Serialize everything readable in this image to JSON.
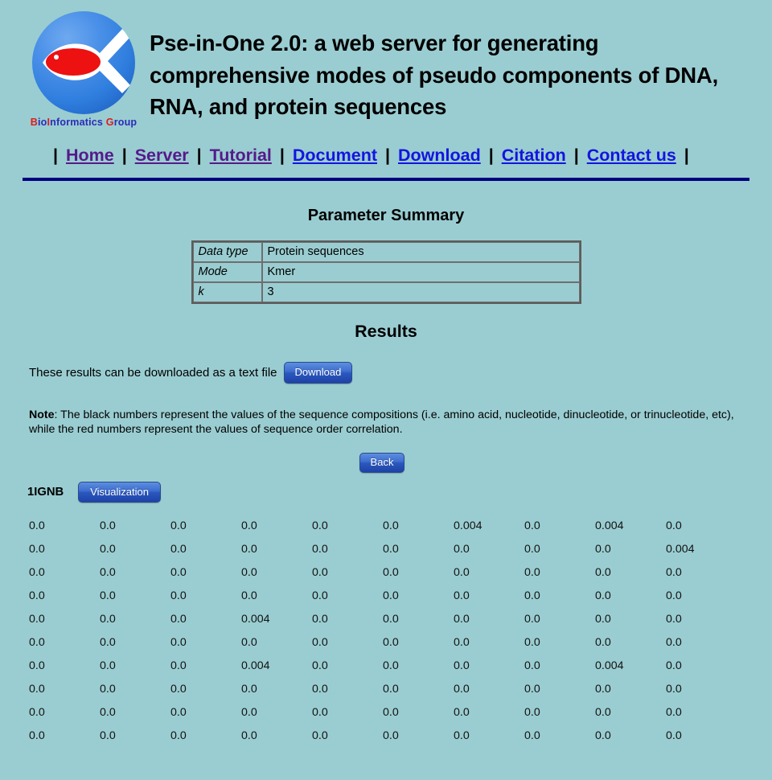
{
  "site": {
    "logo_caption_parts": [
      "B",
      "io",
      "I",
      "nformatics ",
      "G",
      "roup"
    ],
    "logo_caption": "BioInformatics Group",
    "logo_icon": "fish-sphere-logo",
    "title": "Pse-in-One 2.0: a web server for generating comprehensive modes of pseudo components of DNA, RNA, and protein sequences"
  },
  "nav": {
    "leading_sep": "|",
    "trailing_sep": "|",
    "sep": "|",
    "items": [
      {
        "label": "Home",
        "state": "visited"
      },
      {
        "label": "Server",
        "state": "visited"
      },
      {
        "label": "Tutorial",
        "state": "visited"
      },
      {
        "label": "Document",
        "state": "unvisited"
      },
      {
        "label": "Download",
        "state": "unvisited"
      },
      {
        "label": "Citation",
        "state": "unvisited"
      },
      {
        "label": "Contact us",
        "state": "unvisited"
      }
    ]
  },
  "parameter_summary": {
    "heading": "Parameter Summary",
    "rows": [
      {
        "key": "Data type",
        "value": "Protein sequences"
      },
      {
        "key": "Mode",
        "value": "Kmer"
      },
      {
        "key": "k",
        "value": "3"
      }
    ]
  },
  "results": {
    "heading": "Results",
    "download_text": "These results can be downloaded as a text file",
    "download_button": "Download",
    "note_label": "Note",
    "note_body": ": The black numbers represent the values of the sequence compositions (i.e. amino acid, nucleotide, dinucleotide, or trinucleotide, etc), while the red numbers represent the values of sequence order correlation.",
    "back_button": "Back",
    "sequence_id": "1IGNB",
    "visualization_button": "Visualization"
  },
  "colors": {
    "page_background": "#9acdd1",
    "rule": "#000080",
    "link_visited": "#551a8b",
    "link_unvisited": "#1414e0",
    "button_blue": "#2b58bd",
    "composition_number": "#111111",
    "correlation_number": "#cc0000",
    "logo_text_blue": "#2b2bb8",
    "logo_text_red": "#e01b1b"
  },
  "chart_data": {
    "type": "table",
    "title": "Kmer (k=3) feature vector for sequence 1IGNB",
    "columns": 10,
    "values": [
      [
        "0.0",
        "0.0",
        "0.0",
        "0.0",
        "0.0",
        "0.0",
        "0.004",
        "0.0",
        "0.004",
        "0.0"
      ],
      [
        "0.0",
        "0.0",
        "0.0",
        "0.0",
        "0.0",
        "0.0",
        "0.0",
        "0.0",
        "0.0",
        "0.004"
      ],
      [
        "0.0",
        "0.0",
        "0.0",
        "0.0",
        "0.0",
        "0.0",
        "0.0",
        "0.0",
        "0.0",
        "0.0"
      ],
      [
        "0.0",
        "0.0",
        "0.0",
        "0.0",
        "0.0",
        "0.0",
        "0.0",
        "0.0",
        "0.0",
        "0.0"
      ],
      [
        "0.0",
        "0.0",
        "0.0",
        "0.004",
        "0.0",
        "0.0",
        "0.0",
        "0.0",
        "0.0",
        "0.0"
      ],
      [
        "0.0",
        "0.0",
        "0.0",
        "0.0",
        "0.0",
        "0.0",
        "0.0",
        "0.0",
        "0.0",
        "0.0"
      ],
      [
        "0.0",
        "0.0",
        "0.0",
        "0.004",
        "0.0",
        "0.0",
        "0.0",
        "0.0",
        "0.004",
        "0.0"
      ],
      [
        "0.0",
        "0.0",
        "0.0",
        "0.0",
        "0.0",
        "0.0",
        "0.0",
        "0.0",
        "0.0",
        "0.0"
      ],
      [
        "0.0",
        "0.0",
        "0.0",
        "0.0",
        "0.0",
        "0.0",
        "0.0",
        "0.0",
        "0.0",
        "0.0"
      ],
      [
        "0.0",
        "0.0",
        "0.0",
        "0.0",
        "0.0",
        "0.0",
        "0.0",
        "0.0",
        "0.0",
        "0.0"
      ]
    ]
  }
}
